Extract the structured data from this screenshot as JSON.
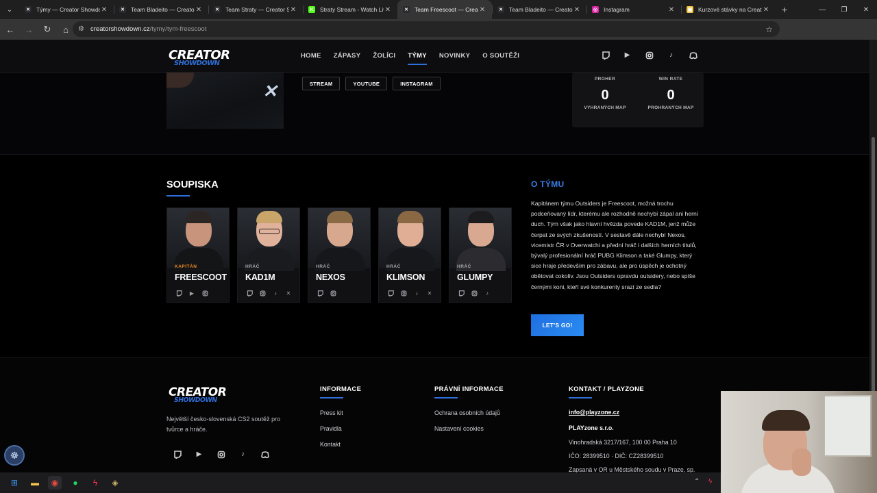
{
  "browser": {
    "tabs": [
      {
        "title": "Týmy — Creator Showdown",
        "favicon_color": "#2a2a2e",
        "favicon_glyph": "✕",
        "active": false
      },
      {
        "title": "Team Bladeito — Creator Showdown",
        "favicon_color": "#2a2a2e",
        "favicon_glyph": "✕",
        "active": false
      },
      {
        "title": "Team Straty — Creator Showdown",
        "favicon_color": "#2a2a2e",
        "favicon_glyph": "✕",
        "active": false
      },
      {
        "title": "Straty Stream - Watch Live",
        "favicon_color": "#53fc18",
        "favicon_glyph": "K",
        "active": false
      },
      {
        "title": "Team Freescoot — Creator Showdown",
        "favicon_color": "#2a2a2e",
        "favicon_glyph": "✕",
        "active": true
      },
      {
        "title": "Team Bladeito — Creator Showdown",
        "favicon_color": "#2a2a2e",
        "favicon_glyph": "✕",
        "active": false
      },
      {
        "title": "Instagram",
        "favicon_color": "#d6249f",
        "favicon_glyph": "◎",
        "active": false
      },
      {
        "title": "Kurzové stávky na Creator Showdown",
        "favicon_color": "#f2c744",
        "favicon_glyph": "▣",
        "active": false
      }
    ],
    "url_host": "creatorshowdown.cz",
    "url_path": "/tymy/tym-freescoot"
  },
  "site": {
    "logo_line1": "CREATOR",
    "logo_line2": "SHOWDOWN",
    "nav": [
      {
        "label": "HOME",
        "active": false
      },
      {
        "label": "ZÁPASY",
        "active": false
      },
      {
        "label": "ŽOLÍCI",
        "active": false
      },
      {
        "label": "TÝMY",
        "active": true
      },
      {
        "label": "NOVINKY",
        "active": false
      },
      {
        "label": "O SOUTĚŽI",
        "active": false
      }
    ],
    "social_icons": [
      "twitch-icon",
      "youtube-icon",
      "instagram-icon",
      "tiktok-icon",
      "discord-icon"
    ]
  },
  "hero": {
    "links": [
      "STREAM",
      "YOUTUBE",
      "INSTAGRAM"
    ],
    "stats": {
      "left_label": "PROHER",
      "right_label": "WIN RATE",
      "won_maps_value": "0",
      "won_maps_label": "VYHRANÝCH MAP",
      "lost_maps_value": "0",
      "lost_maps_label": "PROHRANÝCH MAP"
    }
  },
  "roster": {
    "title": "SOUPISKA",
    "players": [
      {
        "role": "KAPITÁN",
        "name": "FREESCOOT",
        "captain": true,
        "socials": [
          "twitch-icon",
          "youtube-icon",
          "instagram-icon"
        ],
        "hair_color": "#2b2623",
        "skin": "#c8957c",
        "shirt": "#141517"
      },
      {
        "role": "HRÁČ",
        "name": "KAD1M",
        "captain": false,
        "socials": [
          "twitch-icon",
          "instagram-icon",
          "tiktok-icon",
          "x-icon"
        ],
        "hair_color": "#c9a56a",
        "skin": "#e0b29b",
        "shirt": "#1a1b1f"
      },
      {
        "role": "HRÁČ",
        "name": "NEXOS",
        "captain": false,
        "socials": [
          "twitch-icon",
          "instagram-icon"
        ],
        "hair_color": "#8a6a45",
        "skin": "#d8a88e",
        "shirt": "#16171a"
      },
      {
        "role": "HRÁČ",
        "name": "KLIMSON",
        "captain": false,
        "socials": [
          "twitch-icon",
          "instagram-icon",
          "tiktok-icon",
          "x-icon"
        ],
        "hair_color": "#8b6844",
        "skin": "#dfae95",
        "shirt": "#17181b"
      },
      {
        "role": "HRÁČ",
        "name": "GLUMPY",
        "captain": false,
        "socials": [
          "twitch-icon",
          "instagram-icon",
          "tiktok-icon"
        ],
        "hair_color": "#1c1c1e",
        "skin": "#d9a891",
        "shirt": "#2c2c30"
      }
    ]
  },
  "about": {
    "title": "O TÝMU",
    "text": "Kapitánem týmu Outsiders je Freescoot, možná trochu podceňovaný lídr, kterému ale rozhodně nechybí zápal ani herní duch. Tým však jako hlavní hvězda povede KAD1M, jenž může čerpat ze svých zkušeností. V sestavě dále nechybí Nexos, vicemistr ČR v Overwatchi a přední hráč i dalších herních titulů, bývalý profesionální hráč PUBG Klimson a také Glumpy, který sice hraje především pro zábavu, ale pro úspěch je ochotný obětovat cokoliv. Jsou Outsiders opravdu outsidery, nebo spíše černými koni, kteří své konkurenty srazí ze sedla?",
    "cta": "LET'S GO!"
  },
  "footer": {
    "tagline": "Největší česko-slovenská CS2 soutěž pro tvůrce a hráče.",
    "col1_title": "INFORMACE",
    "col1_links": [
      "Press kit",
      "Pravidla",
      "Kontakt"
    ],
    "col2_title": "PRÁVNÍ INFORMACE",
    "col2_links": [
      "Ochrana osobních údajů",
      "Nastavení cookies"
    ],
    "col3_title": "KONTAKT / PLAYZONE",
    "email": "info@playzone.cz",
    "company": "PLAYzone s.r.o.",
    "address": "Vinohradská 3217/167, 100 00 Praha 10",
    "ids": "IČO: 28399510 · DIČ: CZ28399510",
    "registry": "Zapsaná v OR u Městského soudu v Praze, sp."
  },
  "colors": {
    "accent": "#2f6fd8",
    "captain": "#f08a24",
    "about_title": "#3b7de8"
  }
}
